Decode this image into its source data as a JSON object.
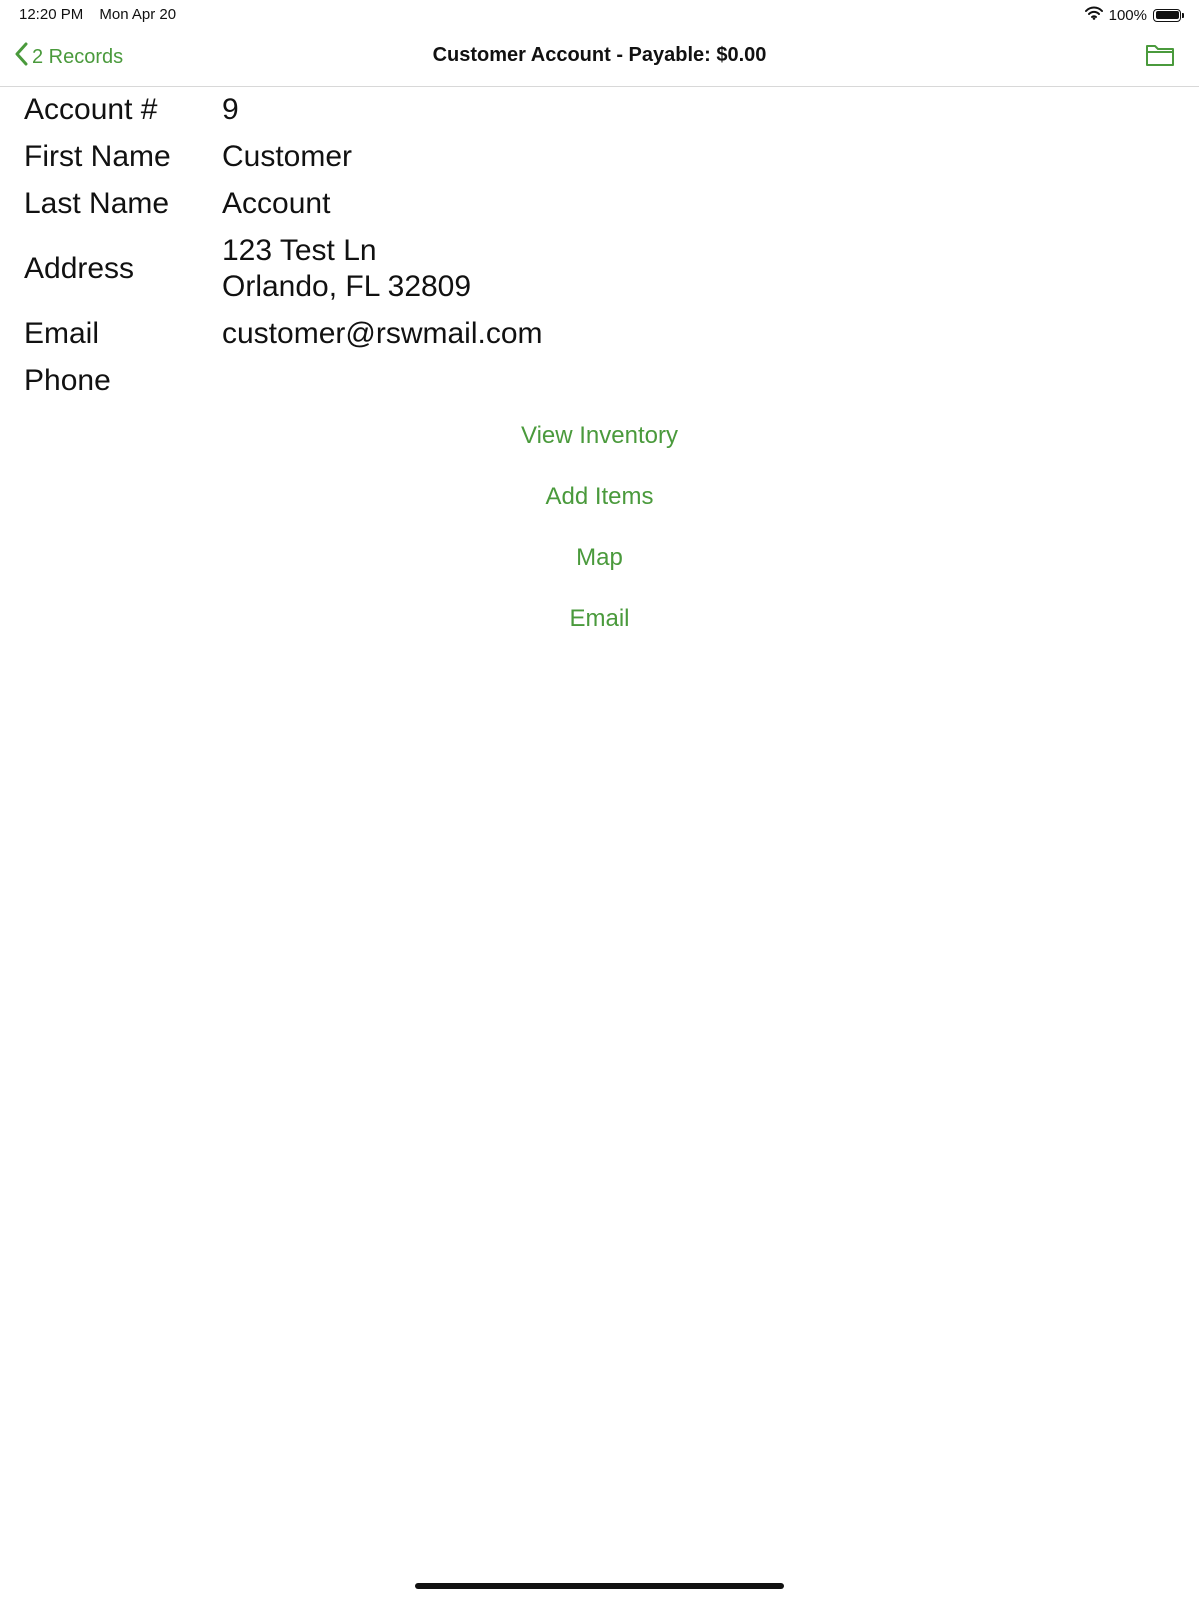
{
  "status_bar": {
    "time": "12:20 PM",
    "date": "Mon Apr 20",
    "battery_percent": "100%",
    "battery_level": 1.0,
    "icons": [
      "wifi-icon",
      "battery-icon"
    ]
  },
  "nav": {
    "back_label": "2 Records",
    "title": "Customer Account - Payable: $0.00",
    "icons": [
      "chevron-left-icon",
      "folder-icon"
    ]
  },
  "details": {
    "account_label": "Account #",
    "account_value": "9",
    "first_name_label": "First Name",
    "first_name_value": "Customer",
    "last_name_label": "Last Name",
    "last_name_value": "Account",
    "address_label": "Address",
    "address_line1": "123 Test Ln",
    "address_line2": "Orlando, FL 32809",
    "email_label": "Email",
    "email_value": "customer@rswmail.com",
    "phone_label": "Phone",
    "phone_value": ""
  },
  "actions": {
    "view_inventory": "View Inventory",
    "add_items": "Add Items",
    "map": "Map",
    "email": "Email"
  },
  "colors": {
    "accent": "#4a9a3c",
    "text": "#111111",
    "divider": "#d8d8d8"
  }
}
